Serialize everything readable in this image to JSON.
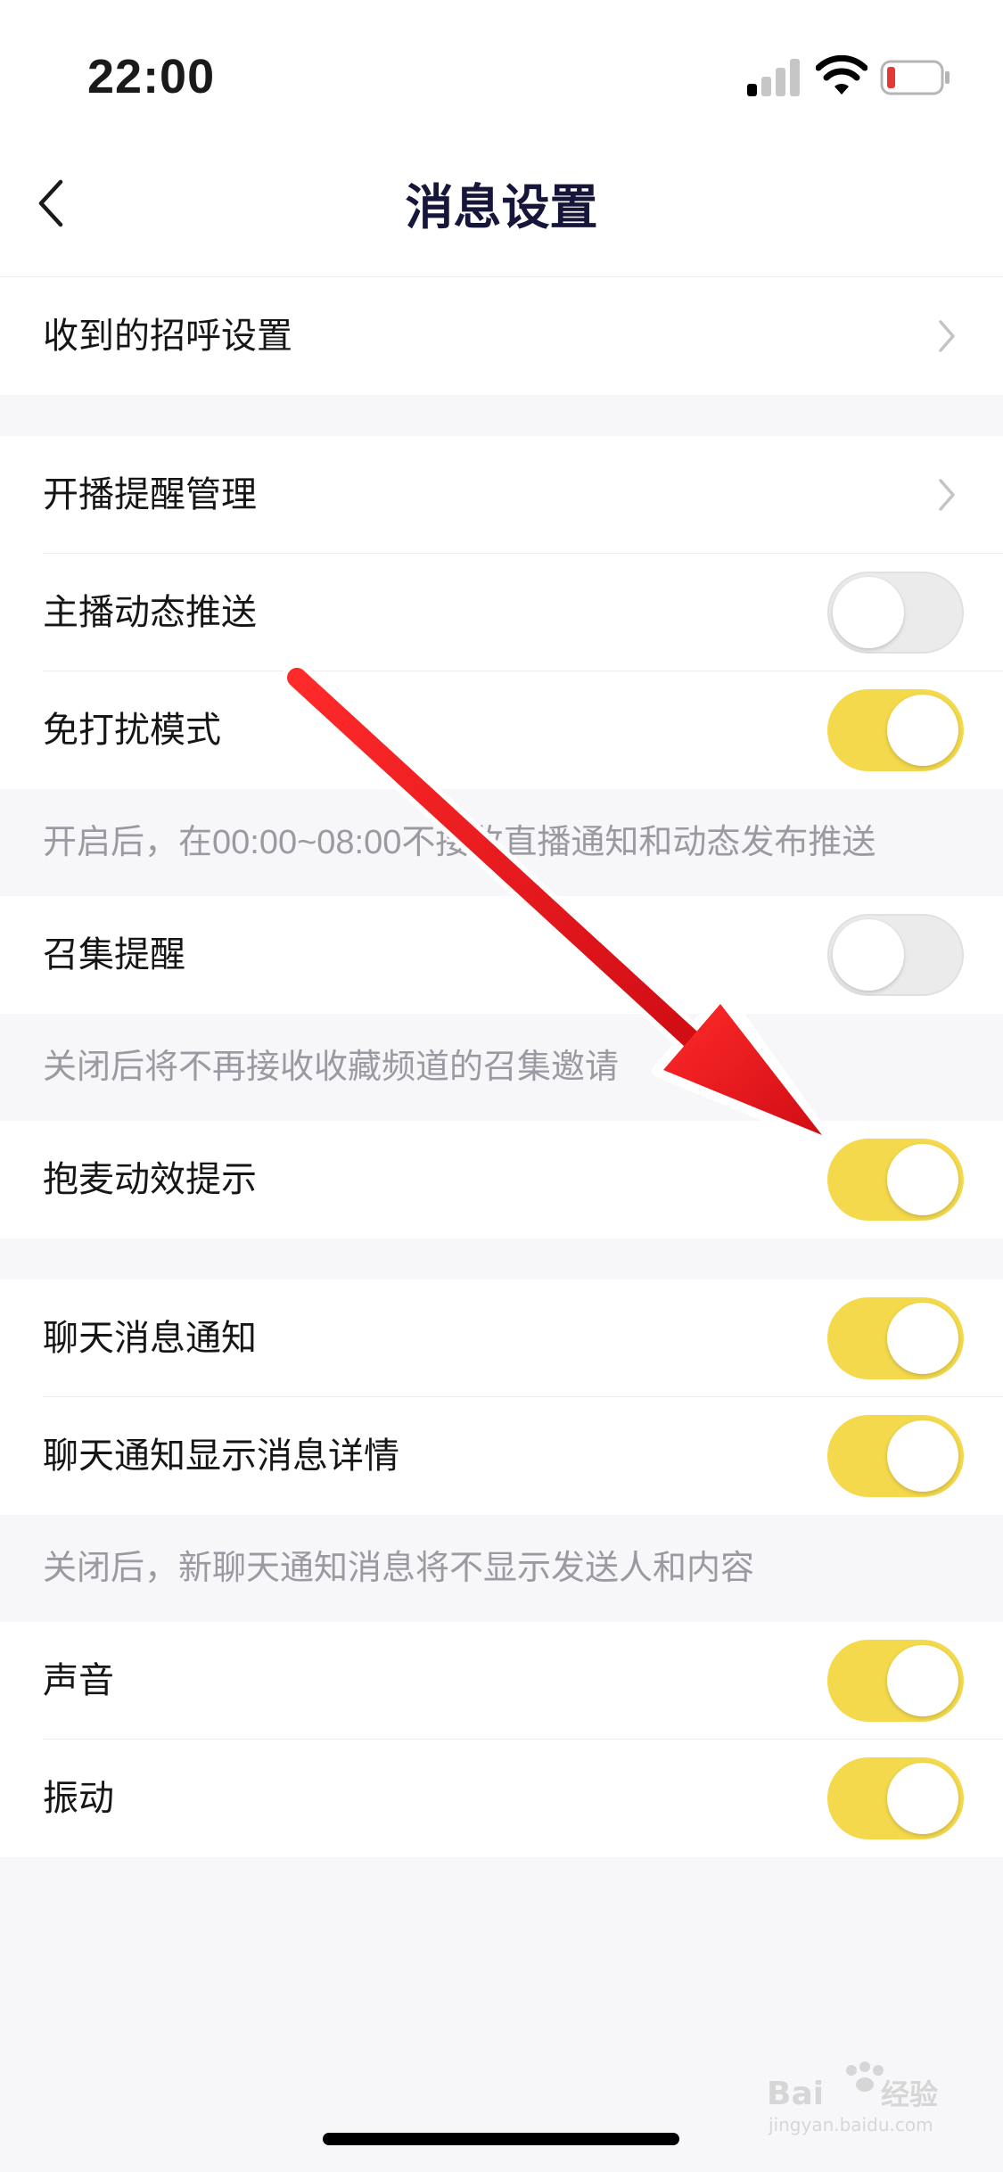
{
  "status_bar": {
    "time": "22:00",
    "signal_bars_active": 1,
    "signal_bars_total": 4,
    "battery_color": "#e53935"
  },
  "nav": {
    "title": "消息设置",
    "back_icon": "chevron-left-icon"
  },
  "rows": [
    {
      "label": "收到的招呼设置",
      "control": "chevron"
    },
    {
      "label": "开播提醒管理",
      "control": "chevron"
    },
    {
      "label": "主播动态推送",
      "control": "toggle",
      "on": false
    },
    {
      "label": "免打扰模式",
      "control": "toggle",
      "on": true
    },
    {
      "label": "召集提醒",
      "control": "toggle",
      "on": false
    },
    {
      "label": "抱麦动效提示",
      "control": "toggle",
      "on": true
    },
    {
      "label": "聊天消息通知",
      "control": "toggle",
      "on": true
    },
    {
      "label": "聊天通知显示消息详情",
      "control": "toggle",
      "on": true
    },
    {
      "label": "声音",
      "control": "toggle",
      "on": true
    },
    {
      "label": "振动",
      "control": "toggle",
      "on": true
    }
  ],
  "notes": {
    "dnd": "开启后，在00:00~08:00不接收直播通知和动态发布推送",
    "gather": "关闭后将不再接收收藏频道的召集邀请",
    "chat_detail": "关闭后，新聊天通知消息将不显示发送人和内容"
  },
  "colors": {
    "toggle_on": "#f4d94c",
    "toggle_off": "#ebebeb",
    "arrow": "#e8121b",
    "background": "#f7f7f9"
  },
  "watermark": {
    "brand": "Baidu",
    "brand_cn": "经验",
    "domain": "jingyan.baidu.com"
  }
}
